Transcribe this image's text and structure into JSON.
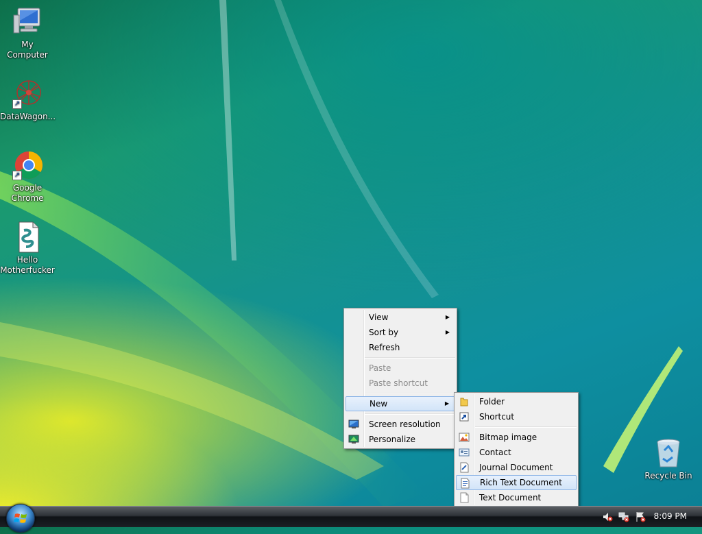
{
  "desktop": {
    "icons": [
      {
        "label": "My Computer",
        "icon": "computer-icon"
      },
      {
        "label": "DataWagon...",
        "icon": "datawagon-icon"
      },
      {
        "label": "Google\nChrome",
        "label_line1": "Google",
        "label_line2": "Chrome",
        "icon": "chrome-icon"
      },
      {
        "label_line1": "Hello",
        "label_line2": "Motherfucker",
        "icon": "script-file-icon"
      },
      {
        "label": "Recycle Bin",
        "icon": "recycle-bin-icon"
      }
    ]
  },
  "context_menu": {
    "items": [
      {
        "label": "View",
        "has_submenu": true
      },
      {
        "label": "Sort by",
        "has_submenu": true
      },
      {
        "label": "Refresh"
      },
      {
        "label": "Paste",
        "disabled": true
      },
      {
        "label": "Paste shortcut",
        "disabled": true
      },
      {
        "label": "New",
        "has_submenu": true,
        "highlighted": true
      },
      {
        "label": "Screen resolution",
        "icon": "monitor-icon"
      },
      {
        "label": "Personalize",
        "icon": "personalize-icon"
      }
    ]
  },
  "new_submenu": {
    "items": [
      {
        "label": "Folder",
        "icon": "folder-icon"
      },
      {
        "label": "Shortcut",
        "icon": "shortcut-icon"
      },
      {
        "label": "Bitmap image",
        "icon": "bitmap-icon"
      },
      {
        "label": "Contact",
        "icon": "contact-icon"
      },
      {
        "label": "Journal Document",
        "icon": "journal-icon"
      },
      {
        "label": "Rich Text Document",
        "icon": "rtf-icon",
        "highlighted": true
      },
      {
        "label": "Text Document",
        "icon": "text-doc-icon"
      }
    ]
  },
  "taskbar": {
    "clock": "8:09 PM",
    "tray_icons": [
      "speaker-muted-icon",
      "network-error-icon",
      "action-center-error-icon"
    ]
  },
  "colors": {
    "menu_bg": "#f0f0f0",
    "menu_highlight": "#d2e4f8",
    "menu_highlight_border": "#8fb6e6",
    "taskbar": "#1b1f24"
  }
}
